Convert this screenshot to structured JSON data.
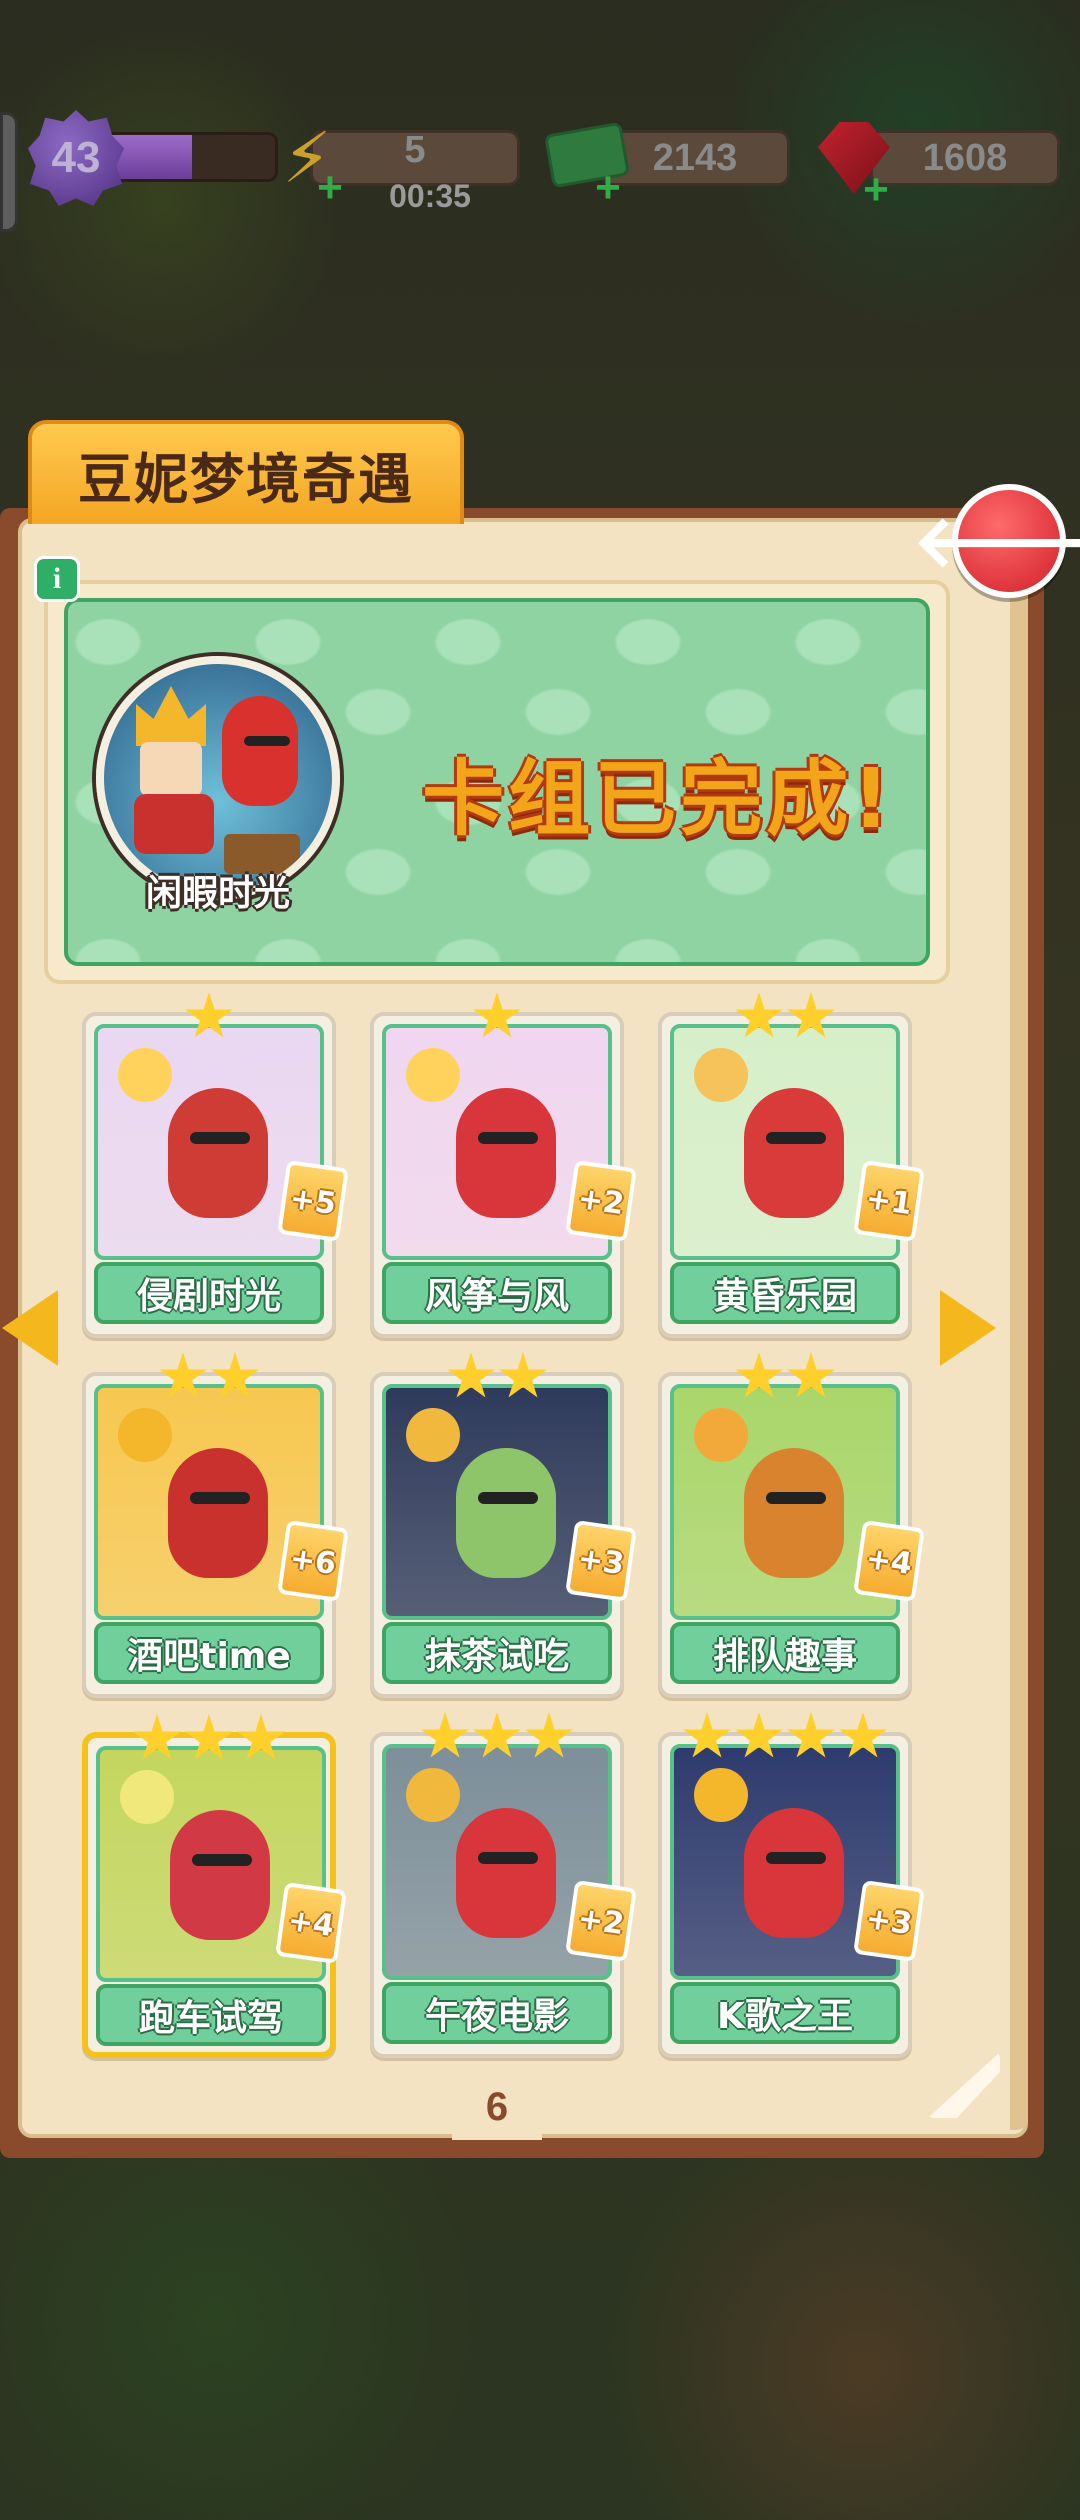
{
  "hud": {
    "level": "43",
    "level_progress": 0.55,
    "energy": "5",
    "energy_timer": "00:35",
    "cash": "2143",
    "gems": "1608"
  },
  "panel": {
    "title": "豆妮梦境奇遇",
    "info_icon": "i",
    "back_icon": "back-arrow-icon"
  },
  "banner": {
    "avatar_label": "闲暇时光",
    "complete_text": "卡组已完成!"
  },
  "cards": [
    {
      "label": "侵剧时光",
      "count": "+5",
      "stars": 1
    },
    {
      "label": "风筝与风",
      "count": "+2",
      "stars": 1
    },
    {
      "label": "黄昏乐园",
      "count": "+1",
      "stars": 2
    },
    {
      "label": "酒吧time",
      "count": "+6",
      "stars": 2
    },
    {
      "label": "抹茶试吃",
      "count": "+3",
      "stars": 2
    },
    {
      "label": "排队趣事",
      "count": "+4",
      "stars": 2
    },
    {
      "label": "跑车试驾",
      "count": "+4",
      "stars": 3,
      "selected": true
    },
    {
      "label": "午夜电影",
      "count": "+2",
      "stars": 3
    },
    {
      "label": "K歌之王",
      "count": "+3",
      "stars": 4
    }
  ],
  "page": "6"
}
